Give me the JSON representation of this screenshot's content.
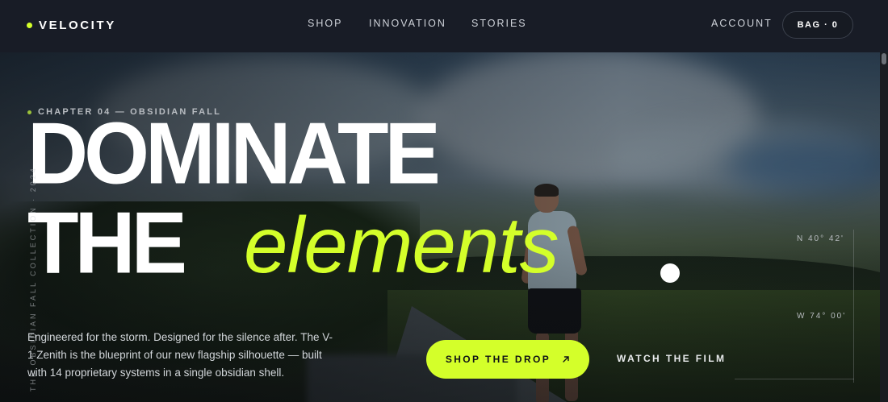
{
  "header": {
    "logo_text": "VELOCITY",
    "nav": [
      "SHOP",
      "INNOVATION",
      "STORIES"
    ],
    "account_label": "ACCOUNT",
    "bag_label": "BAG · 0"
  },
  "hero": {
    "eyebrow": "CHAPTER 04 — OBSIDIAN FALL",
    "headline_line1": "DOMINATE",
    "headline_line2": "THE",
    "headline_accent": "elements",
    "vertical_caption": "THE OBSIDIAN FALL COLLECTION · 2024",
    "coord_north": "N 40° 42'",
    "coord_west": "W 74° 00'",
    "description": "Engineered for the storm. Designed for the silence after. The V-1 Zenith is the blueprint of our new flagship silhouette — built with 14 proprietary systems in a single obsidian shell.",
    "cta_label": "SHOP THE DROP",
    "cta_icon": "arrow-up-right-icon",
    "secondary_link": "WATCH THE FILM"
  },
  "colors": {
    "accent": "#d4ff2a",
    "header_bg": "#181c26",
    "text": "#ffffff"
  }
}
